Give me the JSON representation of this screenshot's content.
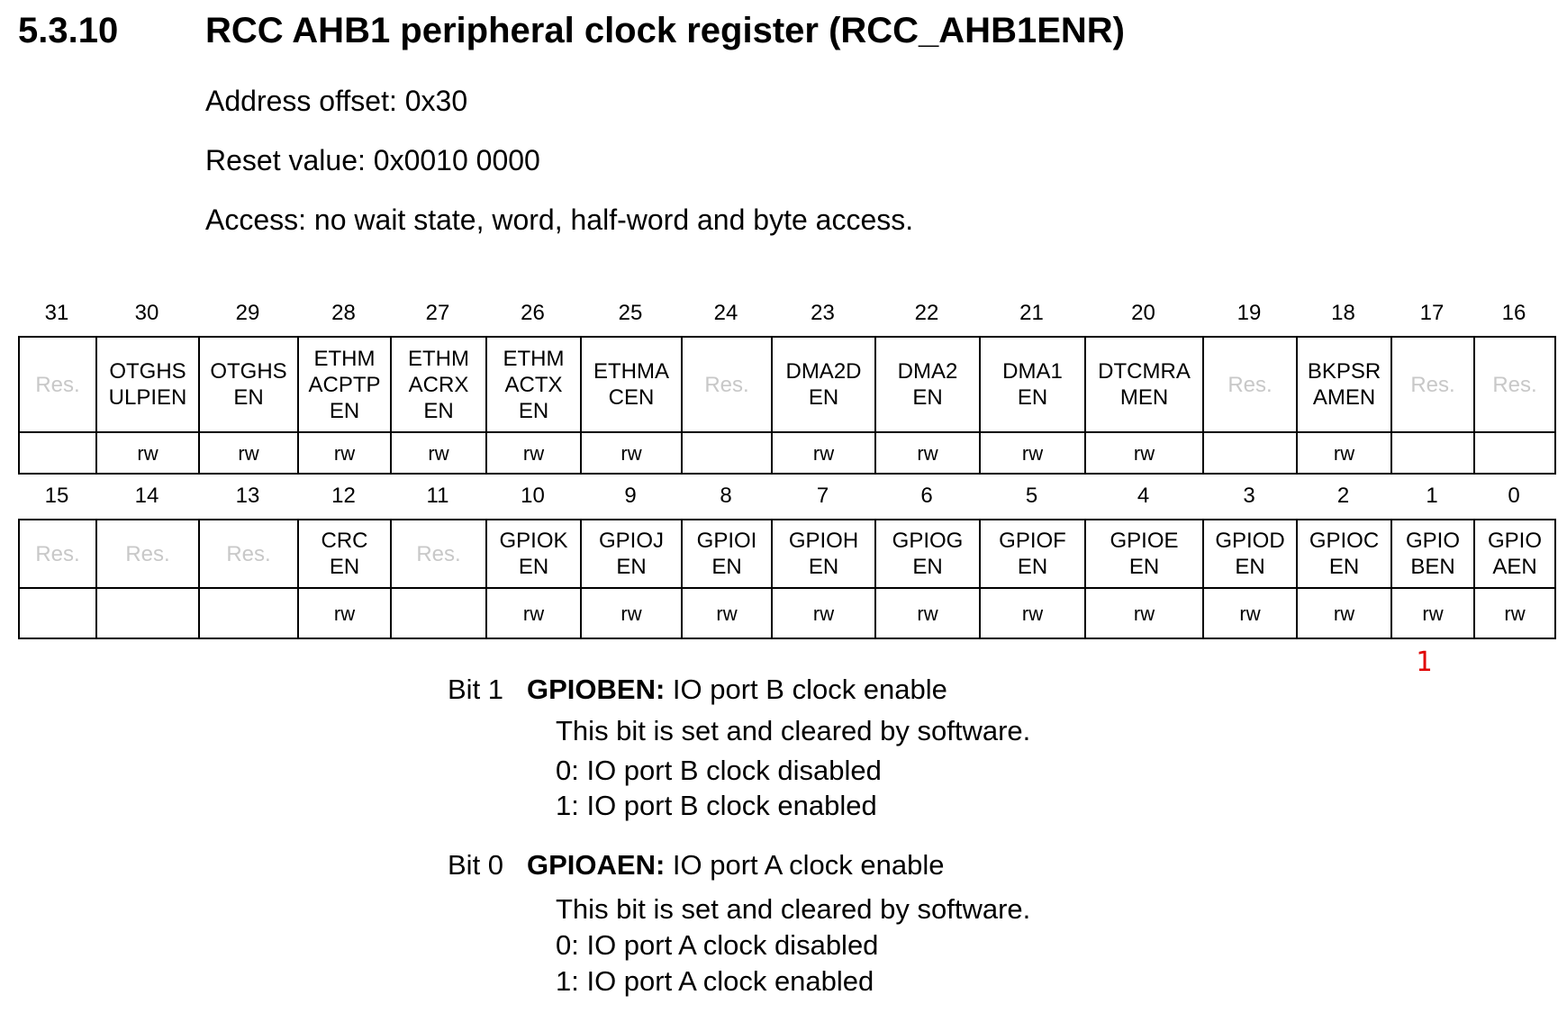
{
  "section": {
    "number": "5.3.10",
    "title": "RCC AHB1 peripheral clock register (RCC_AHB1ENR)"
  },
  "register": {
    "address_offset": "Address offset: 0x30",
    "reset_value": "Reset value: 0x0010 0000",
    "access": "Access: no wait state, word, half-word and byte access."
  },
  "upper_bits": [
    {
      "bit": "31",
      "name": "Res.",
      "access": ""
    },
    {
      "bit": "30",
      "name": "OTGHS\nULPIEN",
      "access": "rw"
    },
    {
      "bit": "29",
      "name": "OTGHS\nEN",
      "access": "rw"
    },
    {
      "bit": "28",
      "name": "ETHM\nACPTP\nEN",
      "access": "rw"
    },
    {
      "bit": "27",
      "name": "ETHM\nACRX\nEN",
      "access": "rw"
    },
    {
      "bit": "26",
      "name": "ETHM\nACTX\nEN",
      "access": "rw"
    },
    {
      "bit": "25",
      "name": "ETHMA\nCEN",
      "access": "rw"
    },
    {
      "bit": "24",
      "name": "Res.",
      "access": ""
    },
    {
      "bit": "23",
      "name": "DMA2D\nEN",
      "access": "rw"
    },
    {
      "bit": "22",
      "name": "DMA2\nEN",
      "access": "rw"
    },
    {
      "bit": "21",
      "name": "DMA1\nEN",
      "access": "rw"
    },
    {
      "bit": "20",
      "name": "DTCMRA\nMEN",
      "access": "rw"
    },
    {
      "bit": "19",
      "name": "Res.",
      "access": ""
    },
    {
      "bit": "18",
      "name": "BKPSR\nAMEN",
      "access": "rw"
    },
    {
      "bit": "17",
      "name": "Res.",
      "access": ""
    },
    {
      "bit": "16",
      "name": "Res.",
      "access": ""
    }
  ],
  "lower_bits": [
    {
      "bit": "15",
      "name": "Res.",
      "access": ""
    },
    {
      "bit": "14",
      "name": "Res.",
      "access": ""
    },
    {
      "bit": "13",
      "name": "Res.",
      "access": ""
    },
    {
      "bit": "12",
      "name": "CRC\nEN",
      "access": "rw"
    },
    {
      "bit": "11",
      "name": "Res.",
      "access": ""
    },
    {
      "bit": "10",
      "name": "GPIOK\nEN",
      "access": "rw"
    },
    {
      "bit": "9",
      "name": "GPIOJ\nEN",
      "access": "rw"
    },
    {
      "bit": "8",
      "name": "GPIOI\nEN",
      "access": "rw"
    },
    {
      "bit": "7",
      "name": "GPIOH\nEN",
      "access": "rw"
    },
    {
      "bit": "6",
      "name": "GPIOG\nEN",
      "access": "rw"
    },
    {
      "bit": "5",
      "name": "GPIOF\nEN",
      "access": "rw"
    },
    {
      "bit": "4",
      "name": "GPIOE\nEN",
      "access": "rw"
    },
    {
      "bit": "3",
      "name": "GPIOD\nEN",
      "access": "rw"
    },
    {
      "bit": "2",
      "name": "GPIOC\nEN",
      "access": "rw"
    },
    {
      "bit": "1",
      "name": "GPIO\nBEN",
      "access": "rw"
    },
    {
      "bit": "0",
      "name": "GPIO\nAEN",
      "access": "rw"
    }
  ],
  "annotation": {
    "marker_text": "1",
    "marker_color": "#e00000"
  },
  "descriptions": [
    {
      "bit_label": "Bit 1",
      "field": "GPIOBEN:",
      "summary": " IO port B clock enable",
      "lines": [
        "This bit is set and cleared by software.",
        "0: IO port B clock disabled",
        "1: IO port B clock enabled"
      ]
    },
    {
      "bit_label": "Bit 0",
      "field": "GPIOAEN:",
      "summary": " IO port A clock enable",
      "lines": [
        "This bit is set and cleared by software.",
        "0: IO port A clock disabled",
        "1: IO port A clock enabled"
      ]
    }
  ]
}
